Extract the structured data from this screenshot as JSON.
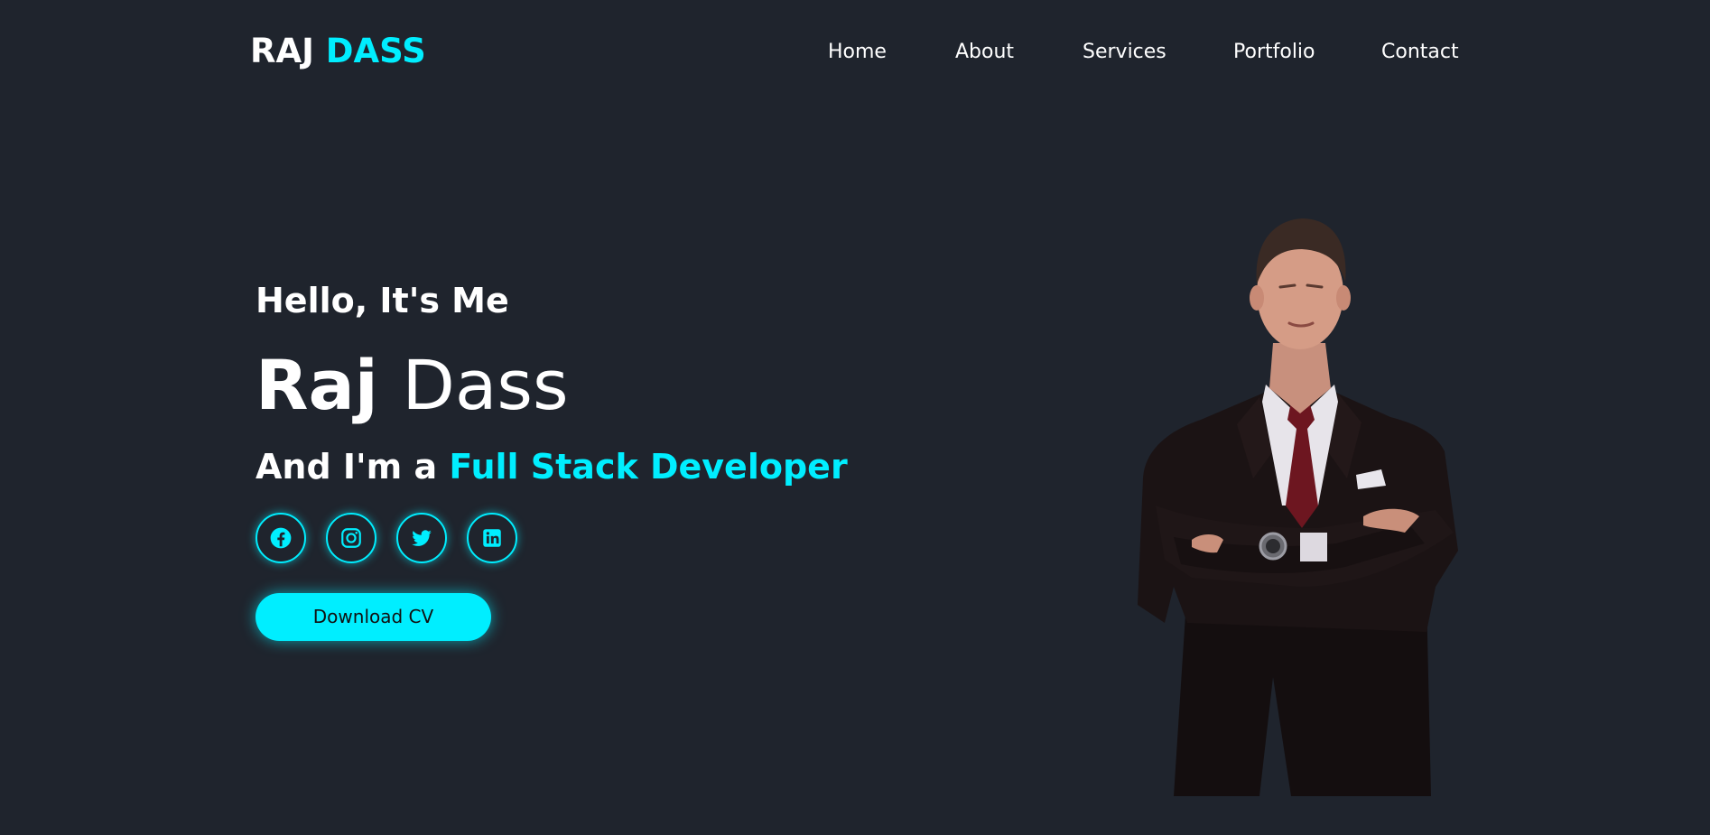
{
  "header": {
    "logo_first": "RAJ",
    "logo_last": "DASS",
    "nav": [
      "Home",
      "About",
      "Services",
      "Portfolio",
      "Contact"
    ]
  },
  "hero": {
    "greeting": "Hello, It's Me",
    "first_name": "Raj",
    "last_name": "Dass",
    "role_prefix": "And I'm a",
    "role": "Full Stack Developer",
    "social_icons": [
      "facebook-icon",
      "instagram-icon",
      "twitter-icon",
      "linkedin-icon"
    ],
    "cta_label": "Download CV"
  },
  "colors": {
    "background": "#1f242d",
    "accent": "#00eeff",
    "text": "#ffffff"
  }
}
